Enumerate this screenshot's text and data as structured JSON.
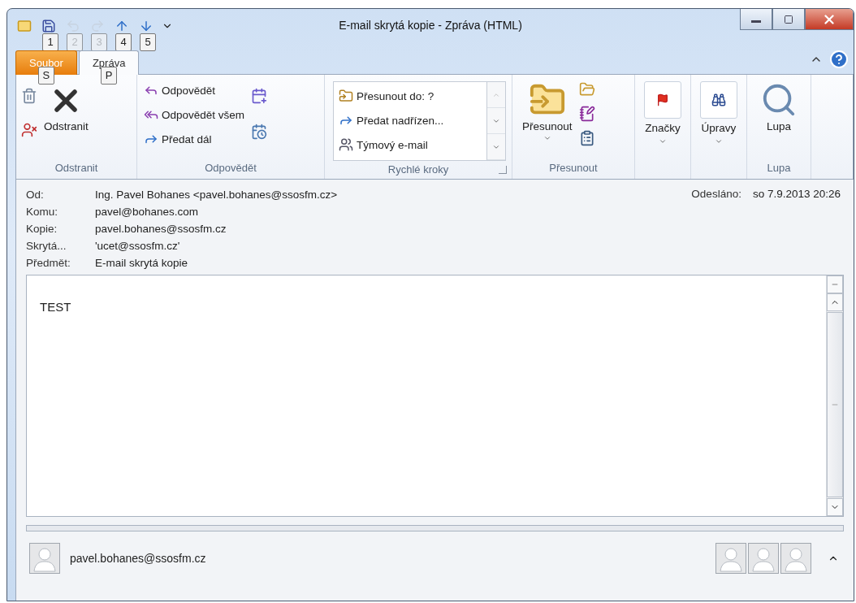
{
  "window": {
    "title": "E-mail skrytá kopie  - Zpráva (HTML)"
  },
  "quick_access": [
    {
      "kind": "save",
      "keytip": "1",
      "disabled": false
    },
    {
      "kind": "undo",
      "keytip": "2",
      "disabled": true
    },
    {
      "kind": "redo",
      "keytip": "3",
      "disabled": true
    },
    {
      "kind": "up",
      "keytip": "4",
      "disabled": false
    },
    {
      "kind": "down",
      "keytip": "5",
      "disabled": false
    }
  ],
  "tabs": [
    {
      "label": "Soubor",
      "kind": "file",
      "selected": false,
      "keytip": "S"
    },
    {
      "label": "Zpráva",
      "kind": "tab",
      "selected": true,
      "keytip": "P"
    }
  ],
  "ribbon": {
    "groups": [
      {
        "kind": "delete",
        "label": "Odstranit",
        "button": "Odstranit"
      },
      {
        "kind": "respond",
        "label": "Odpovědět",
        "items": [
          "Odpovědět",
          "Odpovědět všem",
          "Předat dál"
        ]
      },
      {
        "kind": "quicksteps",
        "label": "Rychlé kroky",
        "items": [
          "Přesunout do: ?",
          "Předat nadřízen...",
          "Týmový e-mail"
        ]
      },
      {
        "kind": "move",
        "label": "Přesunout",
        "button": "Přesunout"
      },
      {
        "kind": "tags",
        "button": "Značky"
      },
      {
        "kind": "editing",
        "button": "Úpravy"
      },
      {
        "kind": "zoom",
        "label": "Lupa",
        "button": "Lupa"
      }
    ]
  },
  "header": {
    "fields": [
      {
        "label": "Od:",
        "value": "Ing. Pavel Bohanes <pavel.bohanes@ssosfm.cz>"
      },
      {
        "label": "Komu:",
        "value": "pavel@bohanes.com"
      },
      {
        "label": "Kopie:",
        "value": "pavel.bohanes@ssosfm.cz"
      },
      {
        "label": "Skrytá...",
        "value": "'ucet@ssosfm.cz'"
      },
      {
        "label": "Předmět:",
        "value": "E-mail skrytá kopie"
      }
    ],
    "sent": {
      "label": "Odesláno:",
      "value": "so 7.9.2013 20:26"
    }
  },
  "body": {
    "text": "TEST"
  },
  "people_pane": {
    "contact": "pavel.bohanes@ssosfm.cz"
  }
}
